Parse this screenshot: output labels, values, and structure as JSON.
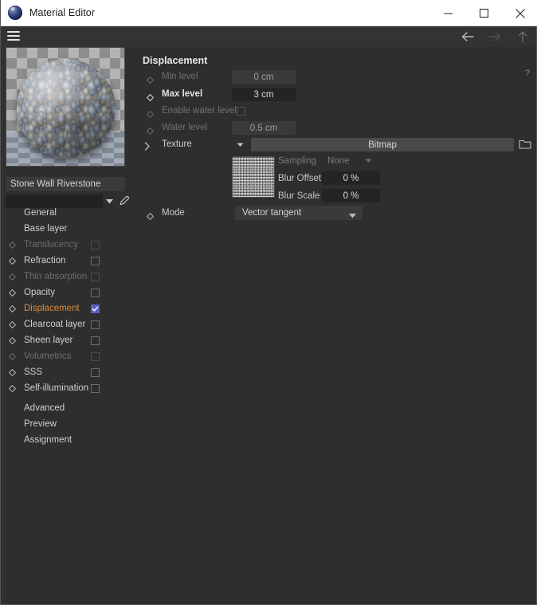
{
  "window": {
    "title": "Material Editor",
    "app_icon": "sphere-icon",
    "controls": {
      "minimize": "minimize-icon",
      "maximize": "maximize-icon",
      "close": "close-icon"
    }
  },
  "toolbar": {
    "menu_icon": "hamburger-icon",
    "nav": [
      {
        "name": "back",
        "icon": "arrow-left-icon",
        "enabled": true
      },
      {
        "name": "forward",
        "icon": "arrow-right-icon",
        "enabled": false
      },
      {
        "name": "up",
        "icon": "arrow-up-icon",
        "enabled": false
      }
    ]
  },
  "left_panel": {
    "preview": {
      "name": "material-preview",
      "alt": "stone sphere preview"
    },
    "material_name": "Stone Wall Riverstone",
    "color_field_value": "",
    "color_dropdown_icon": "chevron-down-icon",
    "eyedropper_icon": "eyedropper-icon",
    "channels": [
      {
        "label": "General",
        "diamond": false,
        "checkbox": "none",
        "enabled": true,
        "selected": false
      },
      {
        "label": "Base layer",
        "diamond": false,
        "checkbox": "none",
        "enabled": true,
        "selected": false
      },
      {
        "label": "Translucency",
        "diamond": true,
        "checkbox": "unchecked",
        "enabled": false,
        "selected": false
      },
      {
        "label": "Refraction",
        "diamond": true,
        "checkbox": "unchecked",
        "enabled": true,
        "selected": false
      },
      {
        "label": "Thin absorption",
        "diamond": true,
        "checkbox": "unchecked",
        "enabled": false,
        "selected": false
      },
      {
        "label": "Opacity",
        "diamond": true,
        "checkbox": "unchecked",
        "enabled": true,
        "selected": false
      },
      {
        "label": "Displacement",
        "diamond": true,
        "checkbox": "checked",
        "enabled": true,
        "selected": true
      },
      {
        "label": "Clearcoat layer",
        "diamond": true,
        "checkbox": "unchecked",
        "enabled": true,
        "selected": false
      },
      {
        "label": "Sheen layer",
        "diamond": true,
        "checkbox": "unchecked",
        "enabled": true,
        "selected": false
      },
      {
        "label": "Volumetrics",
        "diamond": true,
        "checkbox": "unchecked",
        "enabled": false,
        "selected": false
      },
      {
        "label": "SSS",
        "diamond": true,
        "checkbox": "unchecked",
        "enabled": true,
        "selected": false
      },
      {
        "label": "Self-illumination",
        "diamond": true,
        "checkbox": "unchecked",
        "enabled": true,
        "selected": false
      }
    ],
    "pages": [
      {
        "label": "Advanced"
      },
      {
        "label": "Preview"
      },
      {
        "label": "Assignment"
      }
    ]
  },
  "right_panel": {
    "section_title": "Displacement",
    "help_label": "?",
    "rows": {
      "min_level": {
        "label": "Min level",
        "value": "0 cm",
        "enabled": false
      },
      "max_level": {
        "label": "Max level",
        "value": "3 cm",
        "enabled": true
      },
      "enable_water": {
        "label": "Enable water level",
        "checked": false,
        "enabled": false
      },
      "water_level": {
        "label": "Water level",
        "value": "0.5 cm",
        "enabled": false
      }
    },
    "texture": {
      "label": "Texture",
      "expander_icon": "chevron-right-icon",
      "dropdown_icon": "triangle-down-icon",
      "shader_name": "Bitmap",
      "folder_icon": "folder-icon",
      "thumbnail": "noise-texture-thumbnail",
      "sampling_label": "Sampling",
      "sampling_value": "None",
      "blur_offset_label": "Blur Offset",
      "blur_offset_value": "0 %",
      "blur_scale_label": "Blur Scale",
      "blur_scale_value": "0 %"
    },
    "mode": {
      "label": "Mode",
      "value": "Vector tangent",
      "dropdown_icon": "triangle-down-icon"
    }
  },
  "colors": {
    "accent_selected": "#e08c38",
    "checkbox_checked": "#5b5fc7",
    "panel_bg": "#2e2e2e",
    "toolbar_bg": "#333333",
    "titlebar_bg": "#ffffff"
  }
}
